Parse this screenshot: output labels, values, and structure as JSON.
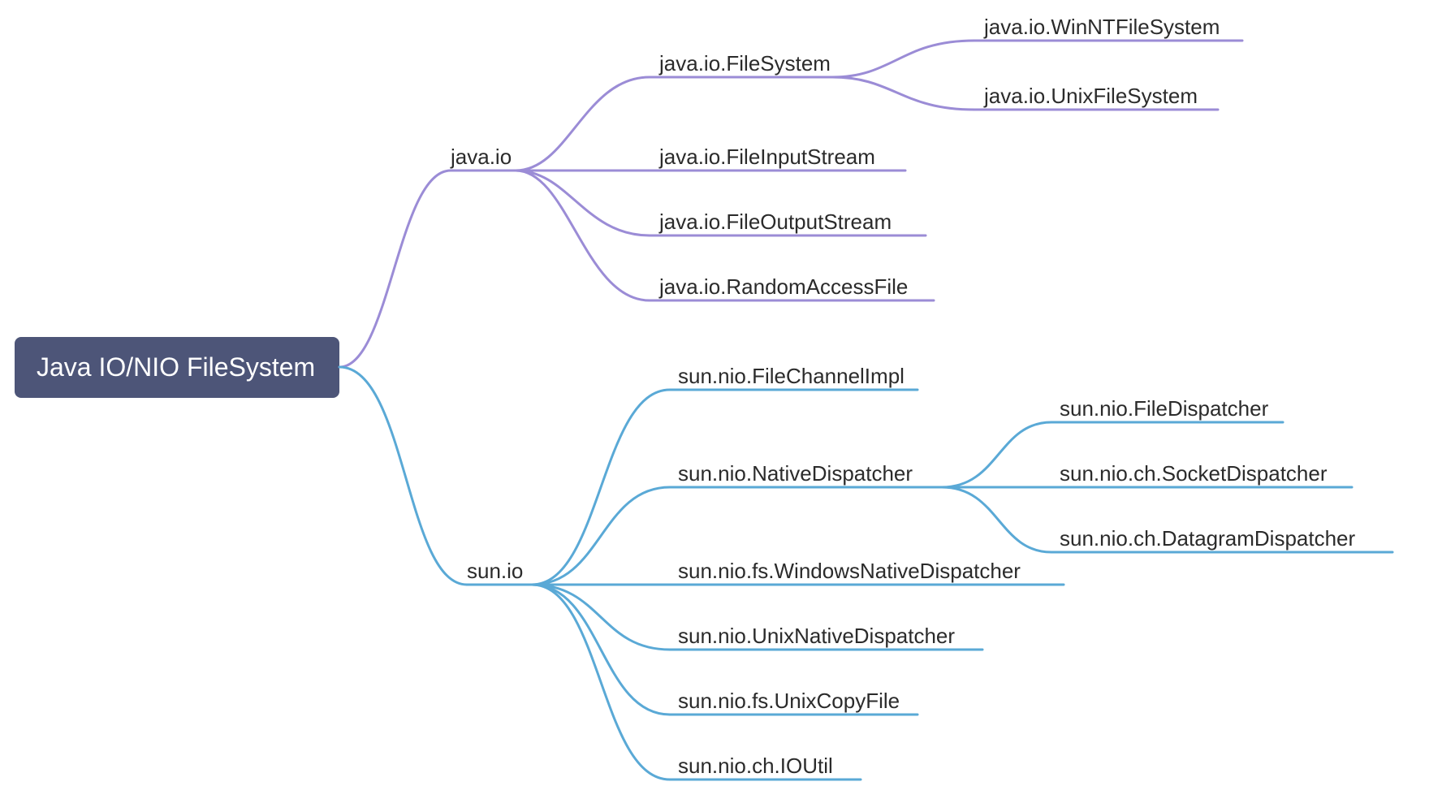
{
  "colors": {
    "purple": "#9b8cd6",
    "blue": "#5aa9d6",
    "rootBg": "#4d5578"
  },
  "root": {
    "label": "Java IO/NIO FileSystem"
  },
  "javaIo": {
    "label": "java.io",
    "children": {
      "fileSystem": {
        "label": "java.io.FileSystem",
        "children": {
          "winnt": "java.io.WinNTFileSystem",
          "unix": "java.io.UnixFileSystem"
        }
      },
      "fileInputStream": "java.io.FileInputStream",
      "fileOutputStream": "java.io.FileOutputStream",
      "randomAccessFile": "java.io.RandomAccessFile"
    }
  },
  "sunIo": {
    "label": "sun.io",
    "children": {
      "fileChannelImpl": "sun.nio.FileChannelImpl",
      "nativeDispatcher": {
        "label": "sun.nio.NativeDispatcher",
        "children": {
          "fileDispatcher": "sun.nio.FileDispatcher",
          "socketDispatcher": "sun.nio.ch.SocketDispatcher",
          "datagramDispatcher": "sun.nio.ch.DatagramDispatcher"
        }
      },
      "windowsNativeDispatcher": "sun.nio.fs.WindowsNativeDispatcher",
      "unixNativeDispatcher": "sun.nio.UnixNativeDispatcher",
      "unixCopyFile": "sun.nio.fs.UnixCopyFile",
      "ioUtil": "sun.nio.ch.IOUtil"
    }
  }
}
